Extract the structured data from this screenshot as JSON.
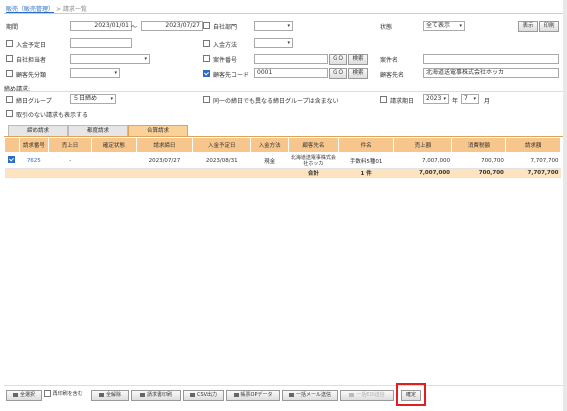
{
  "breadcrumb": {
    "parent": "販売（販売管理）",
    "sep": ">",
    "current": "請求一覧"
  },
  "filters": {
    "period_label": "期間",
    "date_from": "2023/01/01",
    "tilde": "～",
    "date_to": "2023/07/27",
    "own_dept_label": "自社部門",
    "status_label": "状態",
    "status_value": "全て表示",
    "display_btn": "表示",
    "print_btn": "印刷",
    "deposit_date_label": "入金予定日",
    "deposit_method_label": "入金方法",
    "own_staff_label": "自社担当者",
    "project_no_label": "案件番号",
    "go_label": "ＧＯ",
    "search_label": "検索",
    "project_name_label": "案件名",
    "customer_cat_label": "顧客先分類",
    "customer_code_label": "顧客先コード",
    "customer_code_value": "0001",
    "customer_name_label": "顧客先名",
    "customer_name_value": "北海道送電事株式会社ホッカ"
  },
  "closing": {
    "section_label": "締め請求:",
    "group_label": "締日グループ",
    "group_value": "５日締め",
    "diff_group_label": "同一の締日でも異なる締日グループは含まない",
    "month_label": "請求期日",
    "year_value": "2023",
    "year_unit": "年",
    "month_value": "7",
    "month_unit": "月",
    "no_tx_label": "取引のない請求も表示する"
  },
  "tabs": [
    "締め請求",
    "都度請求",
    "合算請求"
  ],
  "table": {
    "headers": [
      "請求番号",
      "売上日",
      "確定状態",
      "請求締日",
      "入金予定日",
      "入金方法",
      "顧客先名",
      "件名",
      "売上額",
      "消費税額",
      "請求額"
    ],
    "rows": [
      {
        "no": "7625",
        "sale_date": "-",
        "status": "",
        "closing": "2023/07/27",
        "deposit": "2023/08/31",
        "method": "現金",
        "customer": "北海道送電事株式会社ホッカ",
        "subject": "手数料5種01",
        "sales": "7,007,000",
        "tax": "700,700",
        "total": "7,707,700"
      }
    ],
    "total": {
      "label": "合計",
      "count": "1 件",
      "sales": "7,007,000",
      "tax": "700,700",
      "total": "7,707,700"
    }
  },
  "footer": {
    "select_all": "全選択",
    "include_past": "再印刷を含む",
    "deselect_all": "全解除",
    "print_invoice": "請求書印刷",
    "csv": "CSV出力",
    "opt_data": "帳票OPデータ",
    "bulk_mail": "一括メール送信",
    "bulk_edi": "一括EDI送信",
    "confirm": "確定"
  },
  "colors": {
    "accent": "#f6c68c",
    "highlight": "#e02020",
    "link": "#2b6cc4"
  }
}
